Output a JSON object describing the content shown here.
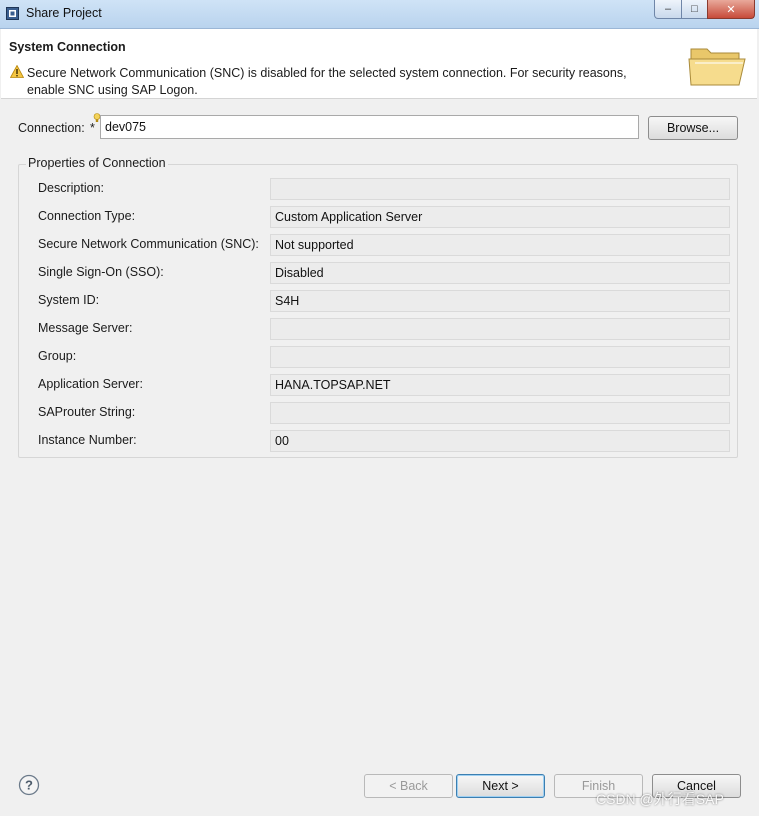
{
  "window": {
    "title": "Share Project",
    "minimize": "–",
    "maximize": "□",
    "close": "✕"
  },
  "banner": {
    "title": "System Connection",
    "message": "Secure Network Communication (SNC) is disabled for the selected system connection. For security reasons, enable SNC using SAP Logon."
  },
  "connection": {
    "label": "Connection:",
    "required_mark": "*",
    "value": "dev075",
    "browse_label": "Browse..."
  },
  "properties": {
    "group_title": "Properties of Connection",
    "rows": [
      {
        "label": "Description:",
        "value": ""
      },
      {
        "label": "Connection Type:",
        "value": "Custom Application Server"
      },
      {
        "label": "Secure Network Communication (SNC):",
        "value": "Not supported"
      },
      {
        "label": "Single Sign-On (SSO):",
        "value": "Disabled"
      },
      {
        "label": "System ID:",
        "value": "S4H"
      },
      {
        "label": "Message Server:",
        "value": ""
      },
      {
        "label": "Group:",
        "value": ""
      },
      {
        "label": "Application Server:",
        "value": "HANA.TOPSAP.NET"
      },
      {
        "label": "SAProuter String:",
        "value": ""
      },
      {
        "label": "Instance Number:",
        "value": "00"
      }
    ]
  },
  "footer": {
    "back_label": "< Back",
    "next_label": "Next >",
    "finish_label": "Finish",
    "cancel_label": "Cancel"
  },
  "watermark": "CSDN @外行看SAP"
}
